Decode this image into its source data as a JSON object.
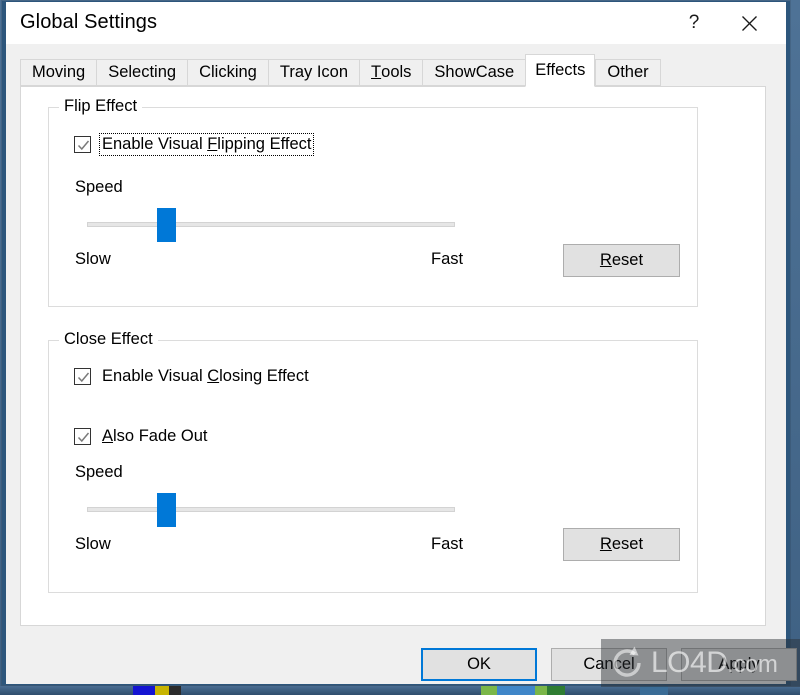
{
  "window": {
    "title": "Global Settings",
    "help_button": "?",
    "close_button": "close-icon"
  },
  "tabs": [
    {
      "label": "Moving",
      "accel": "",
      "active": false
    },
    {
      "label": "Selecting",
      "accel": "",
      "active": false
    },
    {
      "label": "Clicking",
      "accel": "",
      "active": false
    },
    {
      "label": "Tray Icon",
      "accel": "",
      "active": false
    },
    {
      "label": "Tools",
      "accel": "T",
      "active": false
    },
    {
      "label": "ShowCase",
      "accel": "",
      "active": false
    },
    {
      "label": "Effects",
      "accel": "",
      "active": true
    },
    {
      "label": "Other",
      "accel": "",
      "active": false
    }
  ],
  "flip_effect": {
    "group_title": "Flip Effect",
    "checkbox": {
      "label_before": "Enable Visual ",
      "accel": "F",
      "label_after": "lipping Effect",
      "checked": true,
      "focused": true
    },
    "speed_label": "Speed",
    "slider": {
      "value_percent": 20,
      "min_label": "Slow",
      "max_label": "Fast"
    },
    "reset_button": {
      "label_before": "",
      "accel": "R",
      "label_after": "eset"
    }
  },
  "close_effect": {
    "group_title": "Close Effect",
    "checkbox_enable": {
      "label_before": "Enable Visual ",
      "accel": "C",
      "label_after": "losing Effect",
      "checked": true,
      "focused": false
    },
    "checkbox_fade": {
      "label_before": "",
      "accel": "A",
      "label_after": "lso Fade Out",
      "checked": true,
      "focused": false
    },
    "speed_label": "Speed",
    "slider": {
      "value_percent": 20,
      "min_label": "Slow",
      "max_label": "Fast"
    },
    "reset_button": {
      "label_before": "",
      "accel": "R",
      "label_after": "eset"
    }
  },
  "footer": {
    "ok": "OK",
    "cancel": "Cancel",
    "apply": "Apply"
  },
  "watermark": {
    "text": "LO4D",
    "suffix": ".com"
  },
  "colors": {
    "accent": "#0078d7",
    "window_border": "#2d567c",
    "dialog_face": "#f0f0f0",
    "button_face": "#e1e1e1",
    "tab_page": "#ffffff"
  }
}
